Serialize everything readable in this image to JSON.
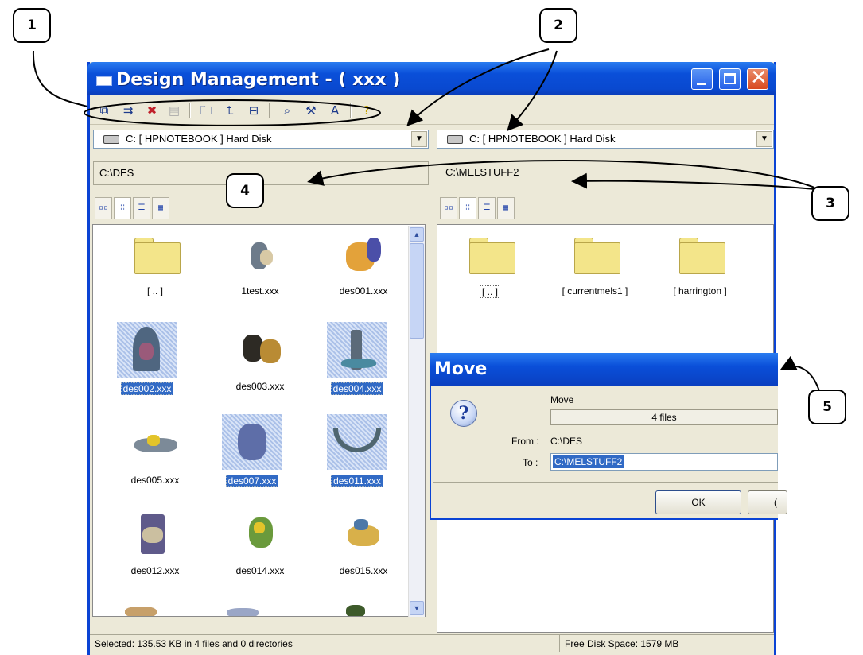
{
  "window": {
    "title": "Design Management  -  ( xxx )"
  },
  "toolbar": {
    "icons": [
      "copy-files-icon",
      "move-files-icon",
      "delete-file-icon",
      "clear-icon",
      "new-folder-icon",
      "parent-folder-icon",
      "split-view-icon",
      "find-icon",
      "tools-icon",
      "sort-icon",
      "help-icon"
    ]
  },
  "left_pane": {
    "drive": "C: [ HPNOTEBOOK ] Hard Disk",
    "path": "C:\\DES",
    "items": [
      {
        "label": "[ .. ]",
        "type": "folder",
        "selected": false
      },
      {
        "label": "1test.xxx",
        "type": "design",
        "selected": false
      },
      {
        "label": "des001.xxx",
        "type": "design",
        "selected": false
      },
      {
        "label": "des002.xxx",
        "type": "design",
        "selected": true
      },
      {
        "label": "des003.xxx",
        "type": "design",
        "selected": false
      },
      {
        "label": "des004.xxx",
        "type": "design",
        "selected": true
      },
      {
        "label": "des005.xxx",
        "type": "design",
        "selected": false
      },
      {
        "label": "des007.xxx",
        "type": "design",
        "selected": true
      },
      {
        "label": "des011.xxx",
        "type": "design",
        "selected": true
      },
      {
        "label": "des012.xxx",
        "type": "design",
        "selected": false
      },
      {
        "label": "des014.xxx",
        "type": "design",
        "selected": false
      },
      {
        "label": "des015.xxx",
        "type": "design",
        "selected": false
      }
    ]
  },
  "right_pane": {
    "drive": "C: [ HPNOTEBOOK ] Hard Disk",
    "path": "C:\\MELSTUFF2",
    "items": [
      {
        "label": "[ .. ]",
        "type": "folder",
        "selected": false
      },
      {
        "label": "[ currentmels1 ]",
        "type": "folder",
        "selected": false
      },
      {
        "label": "[ harrington ]",
        "type": "folder",
        "selected": false
      }
    ]
  },
  "status": {
    "selected": "Selected: 135.53 KB in 4 files and 0 directories",
    "free": "Free Disk Space: 1579 MB"
  },
  "dialog": {
    "title": "Move",
    "heading": "Move",
    "progress_text": "4 files",
    "from_label": "From :",
    "from_value": "C:\\DES",
    "to_label": "To :",
    "to_value": "C:\\MELSTUFF2",
    "ok": "OK",
    "cancel_partial": "("
  },
  "callouts": [
    "1",
    "2",
    "3",
    "4",
    "5"
  ]
}
